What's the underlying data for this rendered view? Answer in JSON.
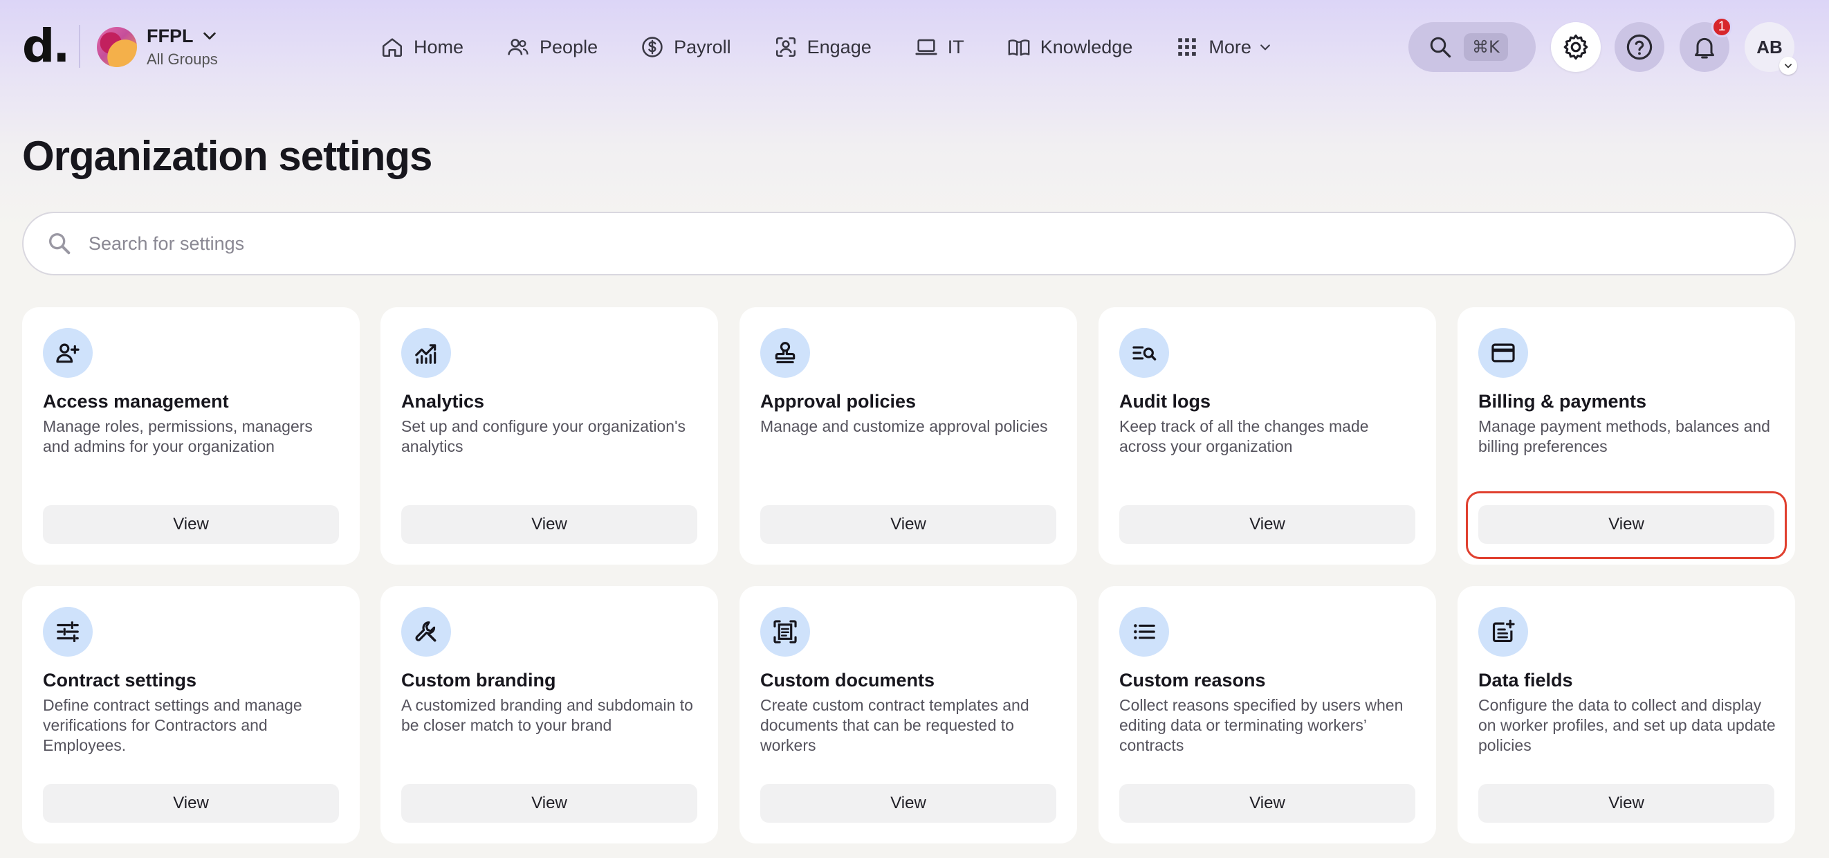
{
  "brand": {
    "logo_text": "d."
  },
  "org": {
    "name": "FFPL",
    "group": "All Groups"
  },
  "nav": {
    "items": [
      {
        "label": "Home",
        "icon": "home-icon"
      },
      {
        "label": "People",
        "icon": "people-icon"
      },
      {
        "label": "Payroll",
        "icon": "dollar-icon"
      },
      {
        "label": "Engage",
        "icon": "engage-icon"
      },
      {
        "label": "IT",
        "icon": "laptop-icon"
      },
      {
        "label": "Knowledge",
        "icon": "book-icon"
      },
      {
        "label": "More",
        "icon": "grid-icon"
      }
    ]
  },
  "header_actions": {
    "search_shortcut": "⌘K",
    "notifications_count": "1",
    "user_initials": "AB"
  },
  "page": {
    "title": "Organization settings",
    "search_placeholder": "Search for settings"
  },
  "cards": [
    {
      "title": "Access management",
      "description": "Manage roles, permissions, managers and admins for your organization",
      "button": "View",
      "icon": "person-add-icon"
    },
    {
      "title": "Analytics",
      "description": "Set up and configure your organization's analytics",
      "button": "View",
      "icon": "analytics-icon"
    },
    {
      "title": "Approval policies",
      "description": "Manage and customize approval policies",
      "button": "View",
      "icon": "stamp-icon"
    },
    {
      "title": "Audit logs",
      "description": "Keep track of all the changes made across your organization",
      "button": "View",
      "icon": "list-search-icon"
    },
    {
      "title": "Billing & payments",
      "description": "Manage payment methods, balances and billing preferences",
      "button": "View",
      "icon": "credit-card-icon",
      "highlighted": true
    },
    {
      "title": "Contract settings",
      "description": "Define contract settings and manage verifications for Contractors and Employees.",
      "button": "View",
      "icon": "sliders-icon"
    },
    {
      "title": "Custom branding",
      "description": "A customized branding and subdomain to be closer match to your brand",
      "button": "View",
      "icon": "wrench-icon"
    },
    {
      "title": "Custom documents",
      "description": "Create custom contract templates and documents that can be requested to workers",
      "button": "View",
      "icon": "document-scan-icon"
    },
    {
      "title": "Custom reasons",
      "description": "Collect reasons specified by users when editing data or terminating workers’ contracts",
      "button": "View",
      "icon": "bulleted-list-icon"
    },
    {
      "title": "Data fields",
      "description": "Configure the data to collect and display on worker profiles, and set up data update policies",
      "button": "View",
      "icon": "note-add-icon"
    }
  ],
  "colors": {
    "header_gradient": "#dcd5f7",
    "icon_bg": "#cfe2fb",
    "highlight": "#e0402f",
    "badge": "#d7262b"
  }
}
